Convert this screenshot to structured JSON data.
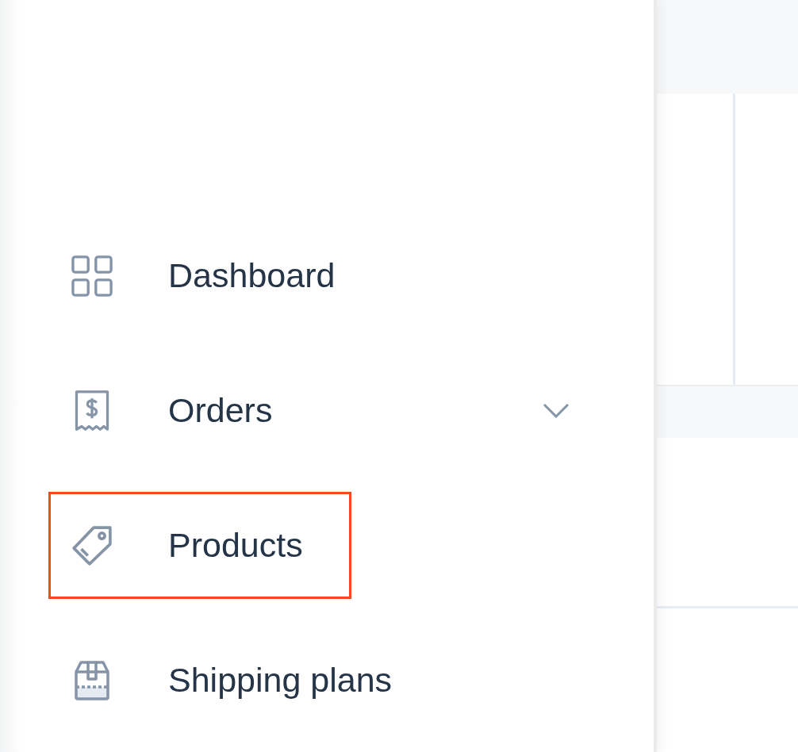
{
  "sidebar": {
    "items": [
      {
        "label": "Dashboard",
        "kind": "link",
        "highlighted": false
      },
      {
        "label": "Orders",
        "kind": "group",
        "expanded": false,
        "highlighted": false
      },
      {
        "label": "Products",
        "kind": "link",
        "highlighted": true
      },
      {
        "label": "Shipping plans",
        "kind": "link",
        "highlighted": false
      }
    ]
  }
}
